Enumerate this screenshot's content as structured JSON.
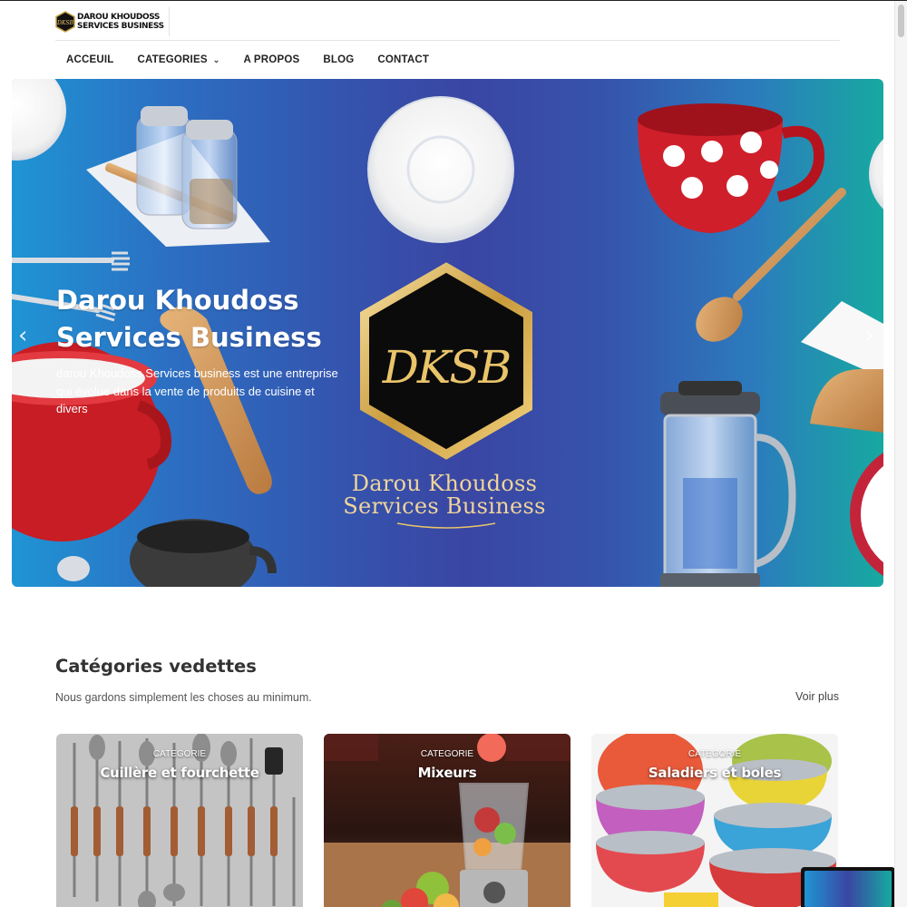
{
  "header": {
    "logo_text_line1": "DAROU KHOUDOSS",
    "logo_text_line2": "SERVICES BUSINESS",
    "logo_monogram": "DKSB"
  },
  "nav": {
    "items": [
      {
        "label": "ACCEUIL"
      },
      {
        "label": "CATEGORIES",
        "icon": "chevron-down-icon"
      },
      {
        "label": "A PROPOS"
      },
      {
        "label": "BLOG"
      },
      {
        "label": "CONTACT"
      }
    ]
  },
  "hero": {
    "title": "Darou Khoudoss Services Business",
    "description": "darou Khoudoss Services business est une entreprise qui évolue dans la vente de produits de cuisine et divers",
    "monogram": "DKSB",
    "wordmark_line1": "Darou Khoudoss",
    "wordmark_line2": "Services Business",
    "prev_icon": "‹",
    "next_icon": "›",
    "colors": {
      "left": "#1f95d4",
      "center": "#3a46a3",
      "right": "#17a9a1",
      "gold": "#e9c46a"
    }
  },
  "featured": {
    "title": "Catégories vedettes",
    "subtitle": "Nous gardons simplement les choses au minimum.",
    "see_more": "Voir plus",
    "cards": [
      {
        "kicker": "CATEGORIE",
        "title": "Cuillère et fourchette"
      },
      {
        "kicker": "CATEGORIE",
        "title": "Mixeurs"
      },
      {
        "kicker": "CATEGORIE",
        "title": "Saladiers et boles"
      }
    ]
  }
}
